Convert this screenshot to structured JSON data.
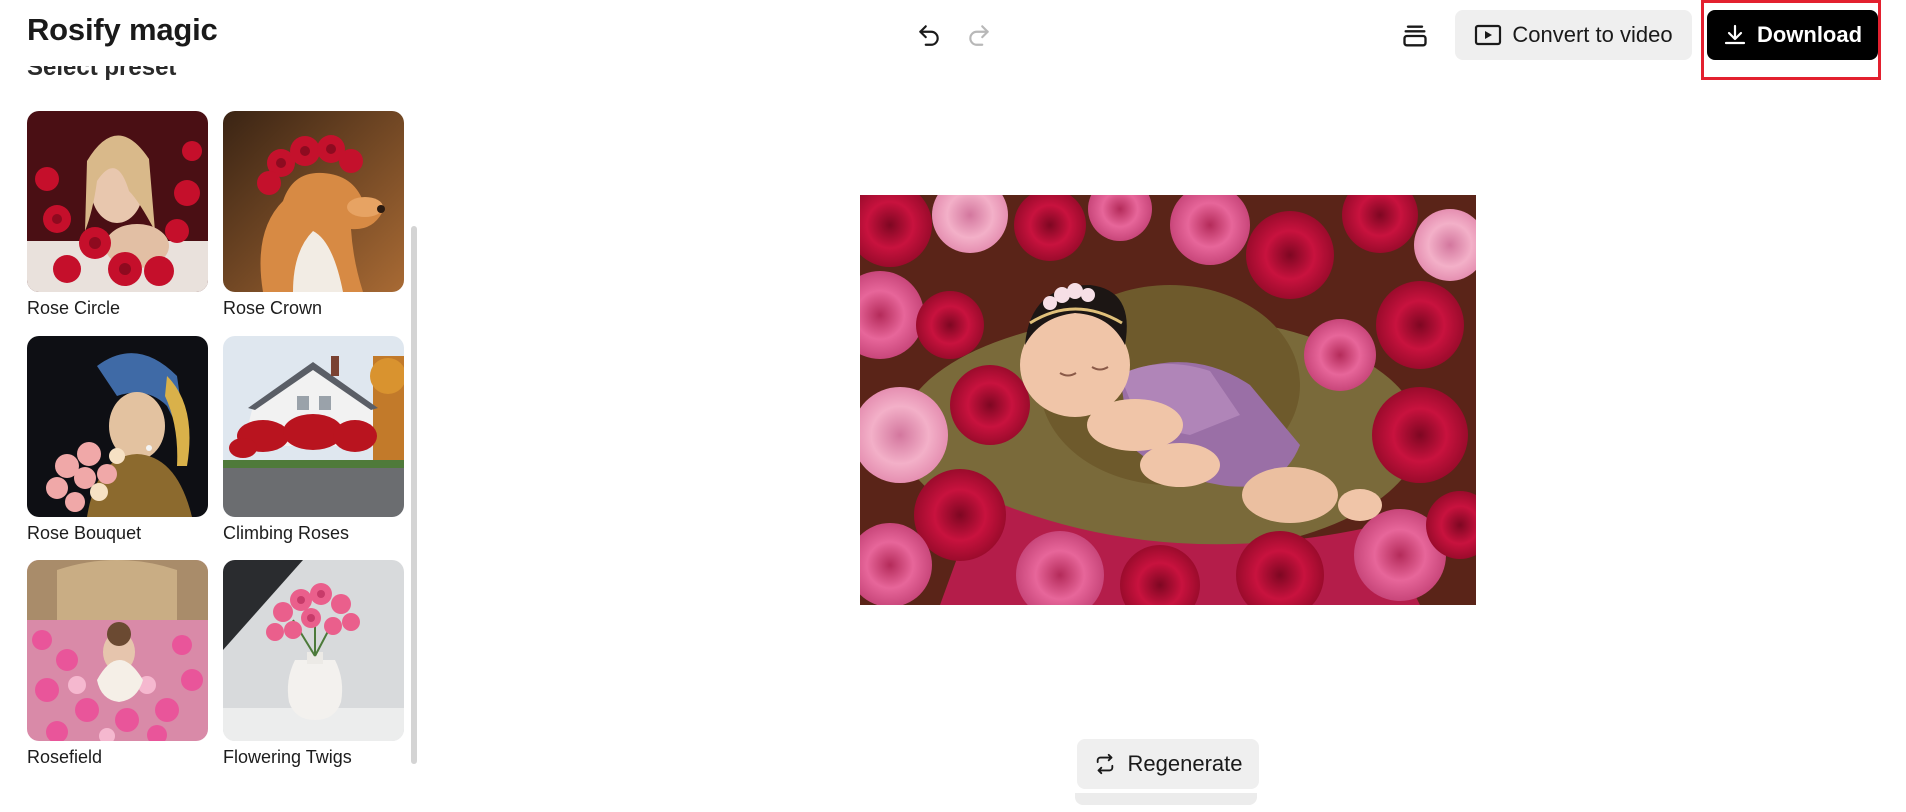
{
  "header": {
    "app_title": "Rosify magic",
    "undo_icon": "undo-icon",
    "redo_icon": "redo-icon",
    "layers_icon": "layers-icon",
    "convert_label": "Convert to video",
    "download_label": "Download"
  },
  "sidebar": {
    "heading": "Select preset",
    "presets": [
      {
        "label": "Rose Circle"
      },
      {
        "label": "Rose Crown"
      },
      {
        "label": "Rose Bouquet"
      },
      {
        "label": "Climbing Roses"
      },
      {
        "label": "Rosefield"
      },
      {
        "label": "Flowering Twigs"
      }
    ]
  },
  "main": {
    "regenerate_label": "Regenerate"
  },
  "colors": {
    "accent_dark": "#000000",
    "button_grey": "#efefef",
    "highlight_red": "#e3202f",
    "rose_crimson": "#c2123f",
    "rose_pink": "#e64c84"
  }
}
